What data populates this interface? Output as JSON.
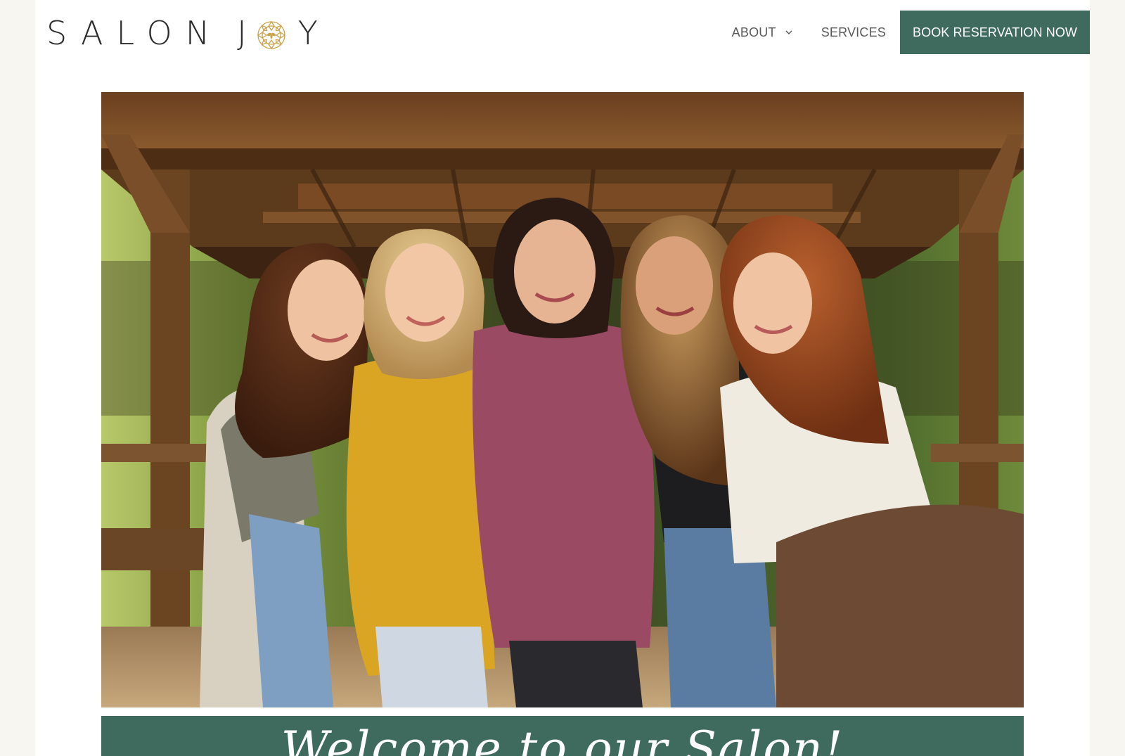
{
  "brand": {
    "name_left": "SALON",
    "name_j": "J",
    "name_y": "Y",
    "emblem": "sun-flower-emblem-icon",
    "emblem_color": "#c9a24a"
  },
  "nav": {
    "about": "About",
    "services": "Services",
    "cta": "Book Reservation Now",
    "chevron_icon": "chevron-down-icon"
  },
  "hero": {
    "image": "group-photo-five-stylists-under-wooden-pavilion"
  },
  "welcome": {
    "text": "Welcome to our Salon!"
  },
  "colors": {
    "accent": "#3f6b5e",
    "page_bg": "#f7f6f1",
    "text": "#5a5a5a"
  }
}
